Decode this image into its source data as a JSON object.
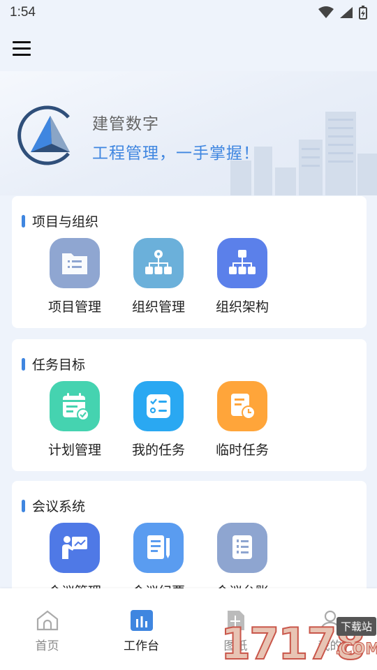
{
  "status_bar": {
    "time": "1:54"
  },
  "brand": {
    "name": "建管数字",
    "slogan": "工程管理，一手掌握！"
  },
  "sections": [
    {
      "title": "项目与组织",
      "items": [
        {
          "label": "项目管理",
          "icon": "folder-list-icon",
          "color": "#8fa6d1"
        },
        {
          "label": "组织管理",
          "icon": "org-gear-icon",
          "color": "#6bb0da"
        },
        {
          "label": "组织架构",
          "icon": "org-chart-icon",
          "color": "#5b80ea"
        }
      ]
    },
    {
      "title": "任务目标",
      "items": [
        {
          "label": "计划管理",
          "icon": "calendar-check-icon",
          "color": "#45d3b0"
        },
        {
          "label": "我的任务",
          "icon": "task-list-icon",
          "color": "#2aa8f2"
        },
        {
          "label": "临时任务",
          "icon": "clock-doc-icon",
          "color": "#ffa53a"
        }
      ]
    },
    {
      "title": "会议系统",
      "items": [
        {
          "label": "会议管理",
          "icon": "presenter-icon",
          "color": "#4f79e6"
        },
        {
          "label": "会议纪要",
          "icon": "notes-pen-icon",
          "color": "#5a9cf0"
        },
        {
          "label": "会议台账",
          "icon": "ledger-icon",
          "color": "#8ea5d0"
        }
      ]
    }
  ],
  "bottom_nav": [
    {
      "label": "首页",
      "icon": "home-icon"
    },
    {
      "label": "工作台",
      "icon": "workbench-chart-icon",
      "active": true
    },
    {
      "label": "图纸",
      "icon": "drawing-icon"
    },
    {
      "label": "我的",
      "icon": "profile-icon"
    }
  ],
  "watermark": {
    "number": "17178",
    "domain": ".COM",
    "badge": "下载站"
  },
  "colors": {
    "accent": "#3f86e0",
    "background": "#eef3fb",
    "card": "#ffffff"
  }
}
